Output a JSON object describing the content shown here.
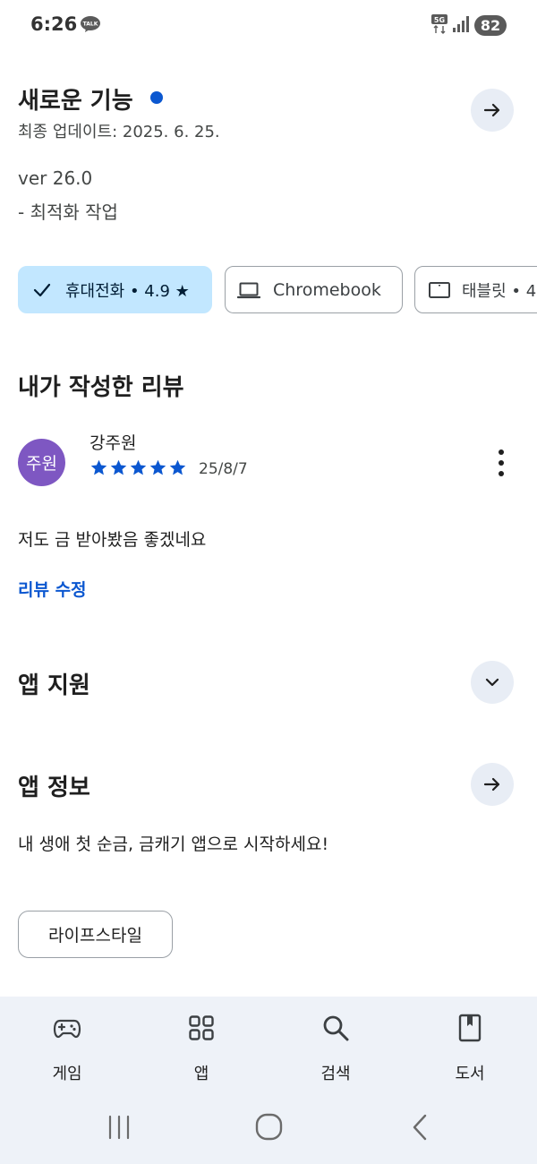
{
  "status_bar": {
    "time": "6:26",
    "talk_badge": "TALK",
    "network": "5G",
    "battery": "82"
  },
  "whats_new": {
    "title": "새로운 기능",
    "updated": "최종 업데이트: 2025. 6. 25.",
    "version": "ver 26.0",
    "note": "- 최적화 작업"
  },
  "device_chips": [
    {
      "label": "휴대전화 • 4.9 ★",
      "icon": "check-icon",
      "selected": true
    },
    {
      "label": "Chromebook",
      "icon": "laptop-icon",
      "selected": false
    },
    {
      "label": "태블릿 • 4",
      "icon": "tablet-icon",
      "selected": false
    }
  ],
  "my_review": {
    "title": "내가 작성한 리뷰",
    "avatar_text": "주원",
    "avatar_color": "#7e57c2",
    "reviewer": "강주원",
    "rating": 5,
    "date": "25/8/7",
    "text": "저도 금 받아봤음 좋겠네요",
    "edit_label": "리뷰 수정"
  },
  "app_support": {
    "title": "앱 지원"
  },
  "app_info": {
    "title": "앱 정보",
    "description": "내 생애 첫 순금, 금캐기 앱으로 시작하세요!",
    "category": "라이프스타일"
  },
  "bottom_nav": [
    {
      "label": "게임",
      "icon": "gamepad-icon"
    },
    {
      "label": "앱",
      "icon": "apps-grid-icon"
    },
    {
      "label": "검색",
      "icon": "search-icon"
    },
    {
      "label": "도서",
      "icon": "book-icon"
    }
  ],
  "colors": {
    "accent": "#0b57d0",
    "chip_selected": "#c2e7ff",
    "nav_bg": "#eef2f8"
  }
}
